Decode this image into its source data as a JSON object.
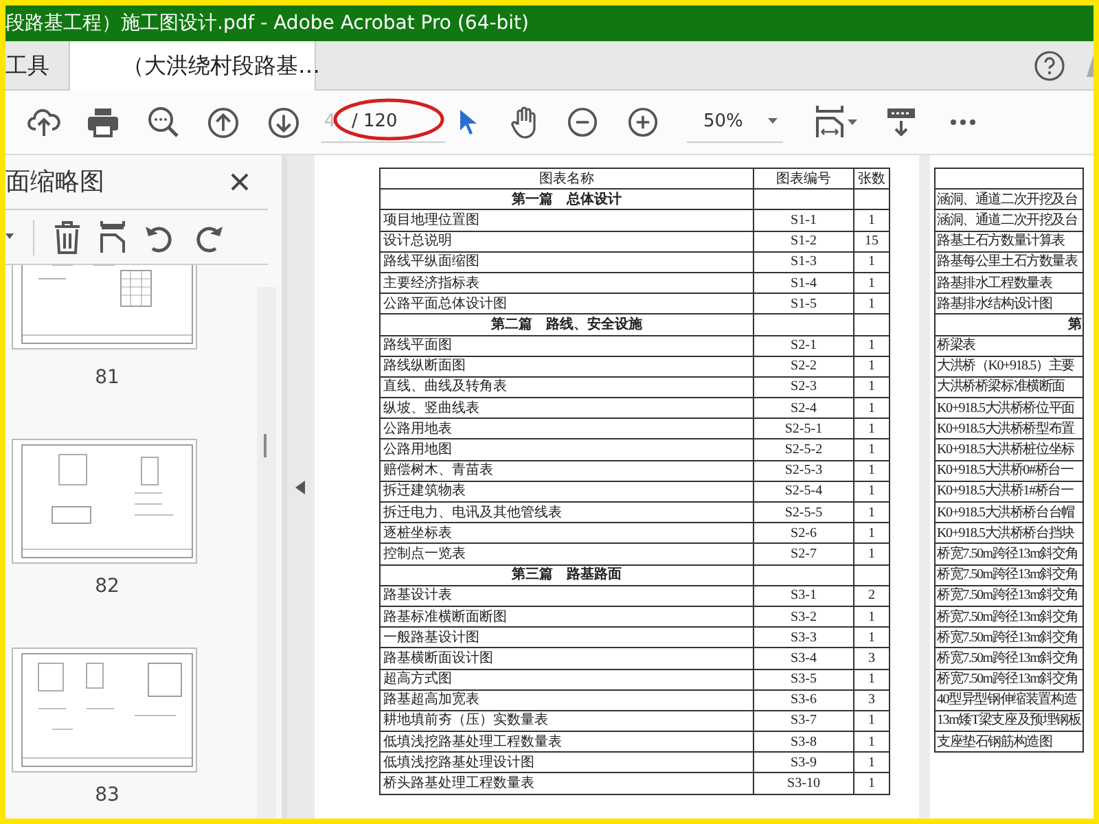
{
  "window": {
    "title": "段路基工程）施工图设计.pdf - Adobe Acrobat Pro (64-bit)"
  },
  "tabs": [
    {
      "label": "工具",
      "selected": false
    },
    {
      "label": "（大洪绕村段路基…",
      "selected": true
    }
  ],
  "toolbar": {
    "page": {
      "value": "4",
      "total": "/ 120"
    },
    "zoom": {
      "value": "50%"
    }
  },
  "thumbnails_panel": {
    "title": "面缩略图",
    "pages": [
      {
        "label": "81"
      },
      {
        "label": "82"
      },
      {
        "label": "83"
      }
    ]
  },
  "document": {
    "pages": [
      {
        "columns": [
          "图表名称",
          "图表编号",
          "张数"
        ],
        "rows": [
          {
            "kind": "section",
            "name": "第一篇　总体设计"
          },
          {
            "kind": "item",
            "name": "项目地理位置图",
            "code": "S1-1",
            "count": "1"
          },
          {
            "kind": "item",
            "name": "设计总说明",
            "code": "S1-2",
            "count": "15"
          },
          {
            "kind": "item",
            "name": "路线平纵面缩图",
            "code": "S1-3",
            "count": "1"
          },
          {
            "kind": "item",
            "name": "主要经济指标表",
            "code": "S1-4",
            "count": "1"
          },
          {
            "kind": "item",
            "name": "公路平面总体设计图",
            "code": "S1-5",
            "count": "1"
          },
          {
            "kind": "section",
            "name": "第二篇　路线、安全设施"
          },
          {
            "kind": "item",
            "name": "路线平面图",
            "code": "S2-1",
            "count": "1"
          },
          {
            "kind": "item",
            "name": "路线纵断面图",
            "code": "S2-2",
            "count": "1"
          },
          {
            "kind": "item",
            "name": "直线、曲线及转角表",
            "code": "S2-3",
            "count": "1"
          },
          {
            "kind": "item",
            "name": "纵坡、竖曲线表",
            "code": "S2-4",
            "count": "1"
          },
          {
            "kind": "item",
            "name": "公路用地表",
            "code": "S2-5-1",
            "count": "1"
          },
          {
            "kind": "item",
            "name": "公路用地图",
            "code": "S2-5-2",
            "count": "1"
          },
          {
            "kind": "item",
            "name": "赔偿树木、青苗表",
            "code": "S2-5-3",
            "count": "1"
          },
          {
            "kind": "item",
            "name": "拆迁建筑物表",
            "code": "S2-5-4",
            "count": "1"
          },
          {
            "kind": "item",
            "name": "拆迁电力、电讯及其他管线表",
            "code": "S2-5-5",
            "count": "1"
          },
          {
            "kind": "item",
            "name": "逐桩坐标表",
            "code": "S2-6",
            "count": "1"
          },
          {
            "kind": "item",
            "name": "控制点一览表",
            "code": "S2-7",
            "count": "1"
          },
          {
            "kind": "section",
            "name": "第三篇　路基路面"
          },
          {
            "kind": "item",
            "name": "路基设计表",
            "code": "S3-1",
            "count": "2"
          },
          {
            "kind": "item",
            "name": "路基标准横断面断图",
            "code": "S3-2",
            "count": "1"
          },
          {
            "kind": "item",
            "name": "一般路基设计图",
            "code": "S3-3",
            "count": "1"
          },
          {
            "kind": "item",
            "name": "路基横断面设计图",
            "code": "S3-4",
            "count": "3"
          },
          {
            "kind": "item",
            "name": "超高方式图",
            "code": "S3-5",
            "count": "1"
          },
          {
            "kind": "item",
            "name": "路基超高加宽表",
            "code": "S3-6",
            "count": "3"
          },
          {
            "kind": "item",
            "name": "耕地填前夯（压）实数量表",
            "code": "S3-7",
            "count": "1"
          },
          {
            "kind": "item",
            "name": "低填浅挖路基处理工程数量表",
            "code": "S3-8",
            "count": "1"
          },
          {
            "kind": "item",
            "name": "低填浅挖路基处理设计图",
            "code": "S3-9",
            "count": "1"
          },
          {
            "kind": "item",
            "name": "桥头路基处理工程数量表",
            "code": "S3-10",
            "count": "1"
          }
        ]
      },
      {
        "rows": [
          {
            "kind": "item",
            "name": "涵洞、通道二次开挖及台"
          },
          {
            "kind": "item",
            "name": "涵洞、通道二次开挖及台"
          },
          {
            "kind": "item",
            "name": "路基土石方数量计算表"
          },
          {
            "kind": "item",
            "name": "路基每公里土石方数量表"
          },
          {
            "kind": "item",
            "name": "路基排水工程数量表"
          },
          {
            "kind": "item",
            "name": "路基排水结构设计图"
          },
          {
            "kind": "section",
            "name": "第"
          },
          {
            "kind": "item",
            "name": "桥梁表"
          },
          {
            "kind": "item",
            "name": "大洪桥（K0+918.5）主要"
          },
          {
            "kind": "item",
            "name": "大洪桥桥梁标准横断面"
          },
          {
            "kind": "item",
            "name": "K0+918.5大洪桥桥位平面"
          },
          {
            "kind": "item",
            "name": "K0+918.5大洪桥桥型布置"
          },
          {
            "kind": "item",
            "name": "K0+918.5大洪桥桩位坐标"
          },
          {
            "kind": "item",
            "name": "K0+918.5大洪桥0#桥台一"
          },
          {
            "kind": "item",
            "name": "K0+918.5大洪桥1#桥台一"
          },
          {
            "kind": "item",
            "name": "K0+918.5大洪桥桥台台帽"
          },
          {
            "kind": "item",
            "name": "K0+918.5大洪桥桥台挡块"
          },
          {
            "kind": "item",
            "name": "桥宽7.50m跨径13m斜交角"
          },
          {
            "kind": "item",
            "name": "桥宽7.50m跨径13m斜交角"
          },
          {
            "kind": "item",
            "name": "桥宽7.50m跨径13m斜交角"
          },
          {
            "kind": "item",
            "name": "桥宽7.50m跨径13m斜交角"
          },
          {
            "kind": "item",
            "name": "桥宽7.50m跨径13m斜交角"
          },
          {
            "kind": "item",
            "name": "桥宽7.50m跨径13m斜交角"
          },
          {
            "kind": "item",
            "name": "桥宽7.50m跨径13m斜交角"
          },
          {
            "kind": "item",
            "name": "40型异型钢伸缩装置构造"
          },
          {
            "kind": "item",
            "name": "13m矮T梁支座及预埋钢板"
          },
          {
            "kind": "item",
            "name": "支座垫石钢筋构造图"
          }
        ]
      }
    ]
  }
}
